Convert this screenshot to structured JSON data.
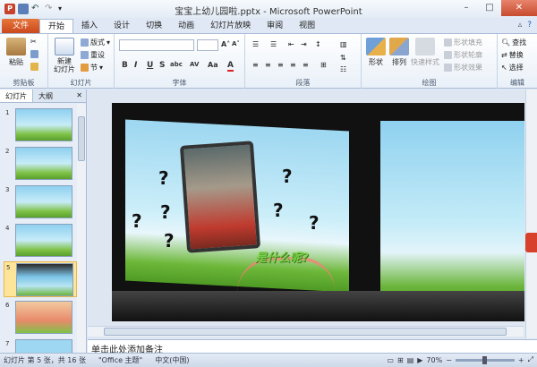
{
  "window": {
    "title": "宝宝上幼儿园啦.pptx - Microsoft PowerPoint",
    "min": "–",
    "max": "□",
    "close": "✕"
  },
  "ribbon_tabs": [
    "文件",
    "开始",
    "插入",
    "设计",
    "切换",
    "动画",
    "幻灯片放映",
    "审阅",
    "视图"
  ],
  "groups": {
    "clipboard": {
      "label": "剪贴板",
      "paste": "粘贴"
    },
    "slides": {
      "label": "幻灯片",
      "new_slide": "新建\n幻灯片",
      "layout": "版式",
      "reset": "重设",
      "section": "节"
    },
    "font": {
      "label": "字体",
      "size_up": "A˄",
      "size_down": "A˅",
      "bold": "B",
      "italic": "I",
      "underline": "U",
      "strike": "S",
      "shadow": "abc",
      "spacing": "AV",
      "case": "Aa",
      "color": "A"
    },
    "paragraph": {
      "label": "段落"
    },
    "drawing": {
      "label": "绘图",
      "shapes": "形状",
      "arrange": "排列",
      "quick_styles": "快速样式",
      "fill": "形状填充",
      "outline": "形状轮廓",
      "effects": "形状效果"
    },
    "editing": {
      "label": "编辑",
      "find": "查找",
      "replace": "替换",
      "select": "选择"
    }
  },
  "pane": {
    "tab_slides": "幻灯片",
    "tab_outline": "大纲",
    "close": "✕",
    "thumbnails": [
      {
        "num": "1"
      },
      {
        "num": "2"
      },
      {
        "num": "3"
      },
      {
        "num": "4"
      },
      {
        "num": "5",
        "selected": true
      },
      {
        "num": "6"
      },
      {
        "num": "7"
      }
    ]
  },
  "slide": {
    "caption": "是什么呢?"
  },
  "notes": {
    "placeholder": "单击此处添加备注"
  },
  "status": {
    "slide_info": "幻灯片 第 5 张，共 16 张",
    "theme": "\"Office 主题\"",
    "language": "中文(中国)",
    "zoom": "70%"
  }
}
